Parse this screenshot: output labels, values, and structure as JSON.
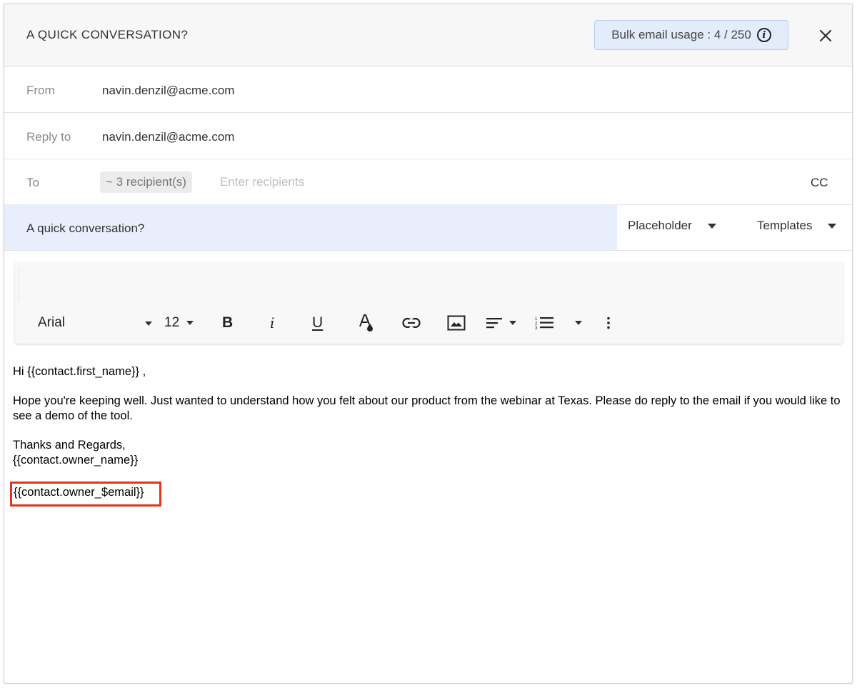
{
  "header": {
    "title": "A QUICK CONVERSATION?",
    "usage_label": "Bulk email usage : 4 / 250",
    "info_icon_glyph": "i",
    "close_glyph": "✕"
  },
  "from": {
    "label": "From",
    "value": "navin.denzil@acme.com"
  },
  "reply_to": {
    "label": "Reply to",
    "value": "navin.denzil@acme.com"
  },
  "to": {
    "label": "To",
    "chip": "~ 3 recipient(s)",
    "placeholder": "Enter recipients",
    "cc_label": "CC"
  },
  "subject": {
    "value": "A quick conversation?",
    "placeholder_dropdown": "Placeholder",
    "templates_dropdown": "Templates"
  },
  "toolbar": {
    "font": "Arial",
    "size": "12",
    "bold": "B",
    "italic": "i",
    "underline": "U",
    "icons": [
      "text-color-icon",
      "link-icon",
      "image-icon",
      "align-icon",
      "numbered-list-icon",
      "more-icon"
    ]
  },
  "body": {
    "greeting": "Hi {{contact.first_name}} ,",
    "paragraph1": "Hope you're keeping well. Just wanted to understand how you felt about our product from the webinar at Texas. Please do reply to the email if you would like to see a demo of the tool.",
    "closing": "Thanks and Regards,",
    "signature_name": "{{contact.owner_name}}",
    "signature_email": "{{contact.owner_$email}}"
  },
  "colors": {
    "accent_highlight": "#e0341f",
    "subject_bg": "#e8eefb",
    "badge_bg": "#e3ecfb"
  }
}
